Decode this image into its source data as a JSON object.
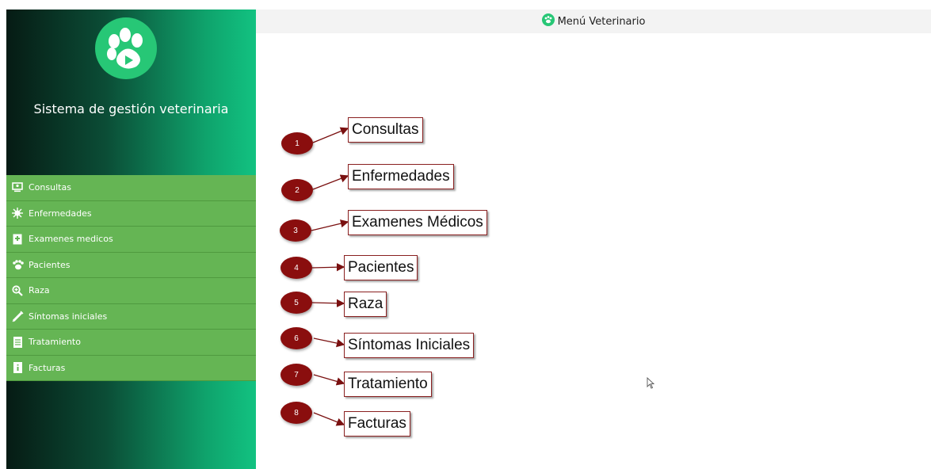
{
  "window": {
    "title": "Menú Veterinario"
  },
  "sidebar": {
    "app_title": "Sistema de gestión veterinaria",
    "items": [
      {
        "label": "Consultas",
        "icon": "monitor-user-icon"
      },
      {
        "label": "Enfermedades",
        "icon": "virus-icon"
      },
      {
        "label": "Examenes medicos",
        "icon": "medical-book-icon"
      },
      {
        "label": "Pacientes",
        "icon": "paw-icon"
      },
      {
        "label": "Raza",
        "icon": "magnify-plus-icon"
      },
      {
        "label": "Síntomas iniciales",
        "icon": "syringe-icon"
      },
      {
        "label": "Tratamiento",
        "icon": "document-icon"
      },
      {
        "label": "Facturas",
        "icon": "invoice-icon"
      }
    ]
  },
  "callouts": [
    {
      "number": "1",
      "label": "Consultas"
    },
    {
      "number": "2",
      "label": "Enfermedades"
    },
    {
      "number": "3",
      "label": "Examenes Médicos"
    },
    {
      "number": "4",
      "label": "Pacientes"
    },
    {
      "number": "5",
      "label": "Raza"
    },
    {
      "number": "6",
      "label": "Síntomas Iniciales"
    },
    {
      "number": "7",
      "label": "Tratamiento"
    },
    {
      "number": "8",
      "label": "Facturas"
    }
  ],
  "colors": {
    "accent": "#27c776",
    "menu": "#65b554",
    "badge": "#8a0e0e"
  }
}
